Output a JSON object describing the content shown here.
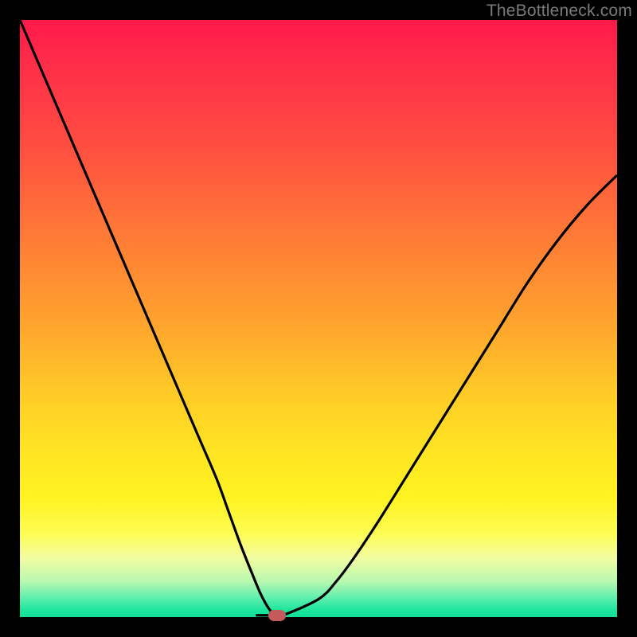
{
  "watermark": "TheBottleneck.com",
  "colors": {
    "background": "#000000",
    "curve": "#000000",
    "marker": "#c45a5a"
  },
  "chart_data": {
    "type": "line",
    "title": "",
    "xlabel": "",
    "ylabel": "",
    "xlim": [
      0,
      100
    ],
    "ylim": [
      0,
      100
    ],
    "grid": false,
    "legend": false,
    "series": [
      {
        "name": "bottleneck-curve",
        "x": [
          0,
          3,
          6,
          9,
          12,
          15,
          18,
          21,
          24,
          27,
          30,
          33,
          35,
          37,
          39,
          40.5,
          42,
          43,
          44,
          50,
          53,
          56,
          60,
          65,
          70,
          75,
          80,
          85,
          90,
          95,
          100
        ],
        "y": [
          100,
          93,
          86,
          79,
          72,
          65,
          58,
          51,
          44,
          37,
          30,
          23,
          17.5,
          12,
          7,
          3.5,
          1,
          0.5,
          0.3,
          3,
          6,
          10,
          16,
          24,
          32,
          40,
          48,
          56,
          63,
          69,
          74
        ]
      }
    ],
    "marker": {
      "x": 43,
      "y": 0.3
    },
    "gradient_stops": [
      {
        "pos": 0.0,
        "color": "#ff1a4a"
      },
      {
        "pos": 0.5,
        "color": "#ffa12e"
      },
      {
        "pos": 0.8,
        "color": "#fff321"
      },
      {
        "pos": 1.0,
        "color": "#12de95"
      }
    ]
  }
}
